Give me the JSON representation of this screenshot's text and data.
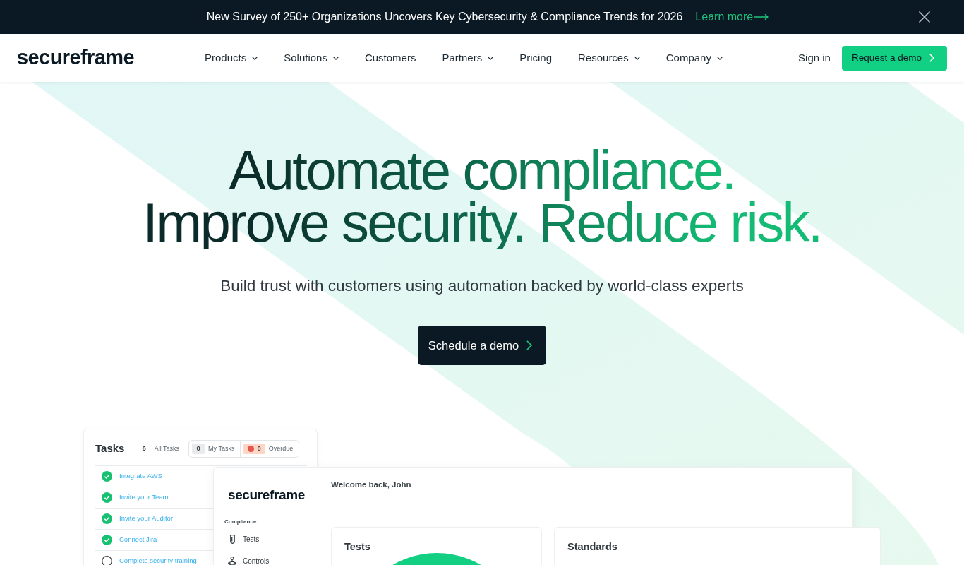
{
  "announcement": {
    "text": "New Survey of 250+ Organizations Uncovers Key Cybersecurity & Compliance Trends for 2026",
    "link": "Learn more"
  },
  "navbar": {
    "logo": "secureframe",
    "items": [
      {
        "label": "Products",
        "has_menu": true
      },
      {
        "label": "Solutions",
        "has_menu": true
      },
      {
        "label": "Customers",
        "has_menu": false
      },
      {
        "label": "Partners",
        "has_menu": true
      },
      {
        "label": "Pricing",
        "has_menu": false
      },
      {
        "label": "Resources",
        "has_menu": true
      },
      {
        "label": "Company",
        "has_menu": true
      }
    ],
    "sign_in": "Sign in",
    "cta": "Request a demo"
  },
  "hero": {
    "headline_lines": [
      "Automate compliance.",
      "Improve security. Reduce risk."
    ],
    "subtitle": "Build trust with customers using automation backed by world-class experts",
    "cta": "Schedule a demo"
  },
  "tasks_card": {
    "title": "Tasks",
    "total": "6",
    "total_label": "All Tasks",
    "filters": [
      {
        "kind": "mine",
        "count": "0",
        "label": "My Tasks"
      },
      {
        "kind": "overdue",
        "count": "0",
        "label": "Overdue"
      }
    ],
    "tasks": [
      {
        "label": "Integrate AWS",
        "done": true
      },
      {
        "label": "Invite your Team",
        "done": true
      },
      {
        "label": "Invite your Auditor",
        "done": true
      },
      {
        "label": "Connect Jira",
        "done": true
      },
      {
        "label": "Complete security training",
        "done": false
      }
    ]
  },
  "dashboard": {
    "logo": "secureframe",
    "sidebar": {
      "section": "Compliance",
      "items": [
        {
          "kind": "tests",
          "label": "Tests"
        },
        {
          "kind": "controls",
          "label": "Controls"
        }
      ]
    },
    "greeting": "Welcome back, John",
    "panels": [
      {
        "title": "Tests",
        "kind": "donut"
      },
      {
        "title": "Standards",
        "kind": "plain"
      }
    ]
  }
}
